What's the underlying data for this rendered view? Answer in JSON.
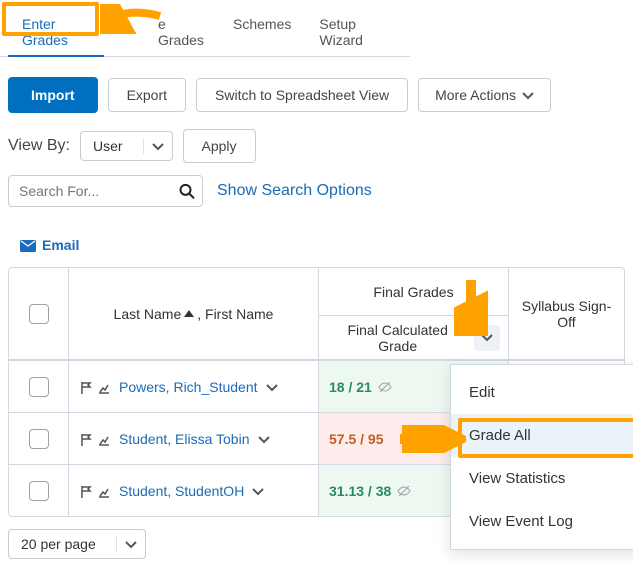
{
  "tabs": {
    "enter_grades": "Enter Grades",
    "manage_grades": "e Grades",
    "schemes": "Schemes",
    "setup_wizard": "Setup Wizard"
  },
  "toolbar": {
    "import_label": "Import",
    "export_label": "Export",
    "spreadsheet_label": "Switch to Spreadsheet View",
    "more_actions_label": "More Actions"
  },
  "viewby": {
    "label": "View By:",
    "selected": "User",
    "apply_label": "Apply"
  },
  "search": {
    "placeholder": "Search For...",
    "options_label": "Show Search Options"
  },
  "email_label": "Email",
  "columns": {
    "name_header_last": "Last Name",
    "name_header_first": "First Name",
    "final_grades_header": "Final Grades",
    "final_calc_header": "Final Calculated Grade",
    "syllabus_header": "Syllabus Sign-Off"
  },
  "rows": [
    {
      "name": "Powers, Rich_Student",
      "grade": "18 / 21"
    },
    {
      "name": "Student, Elissa Tobin",
      "grade": "57.5 / 95"
    },
    {
      "name": "Student, StudentOH",
      "grade": "31.13 / 38"
    }
  ],
  "pager": {
    "label": "20 per page"
  },
  "menu": {
    "edit": "Edit",
    "grade_all": "Grade All",
    "view_statistics": "View Statistics",
    "view_event_log": "View Event Log"
  }
}
